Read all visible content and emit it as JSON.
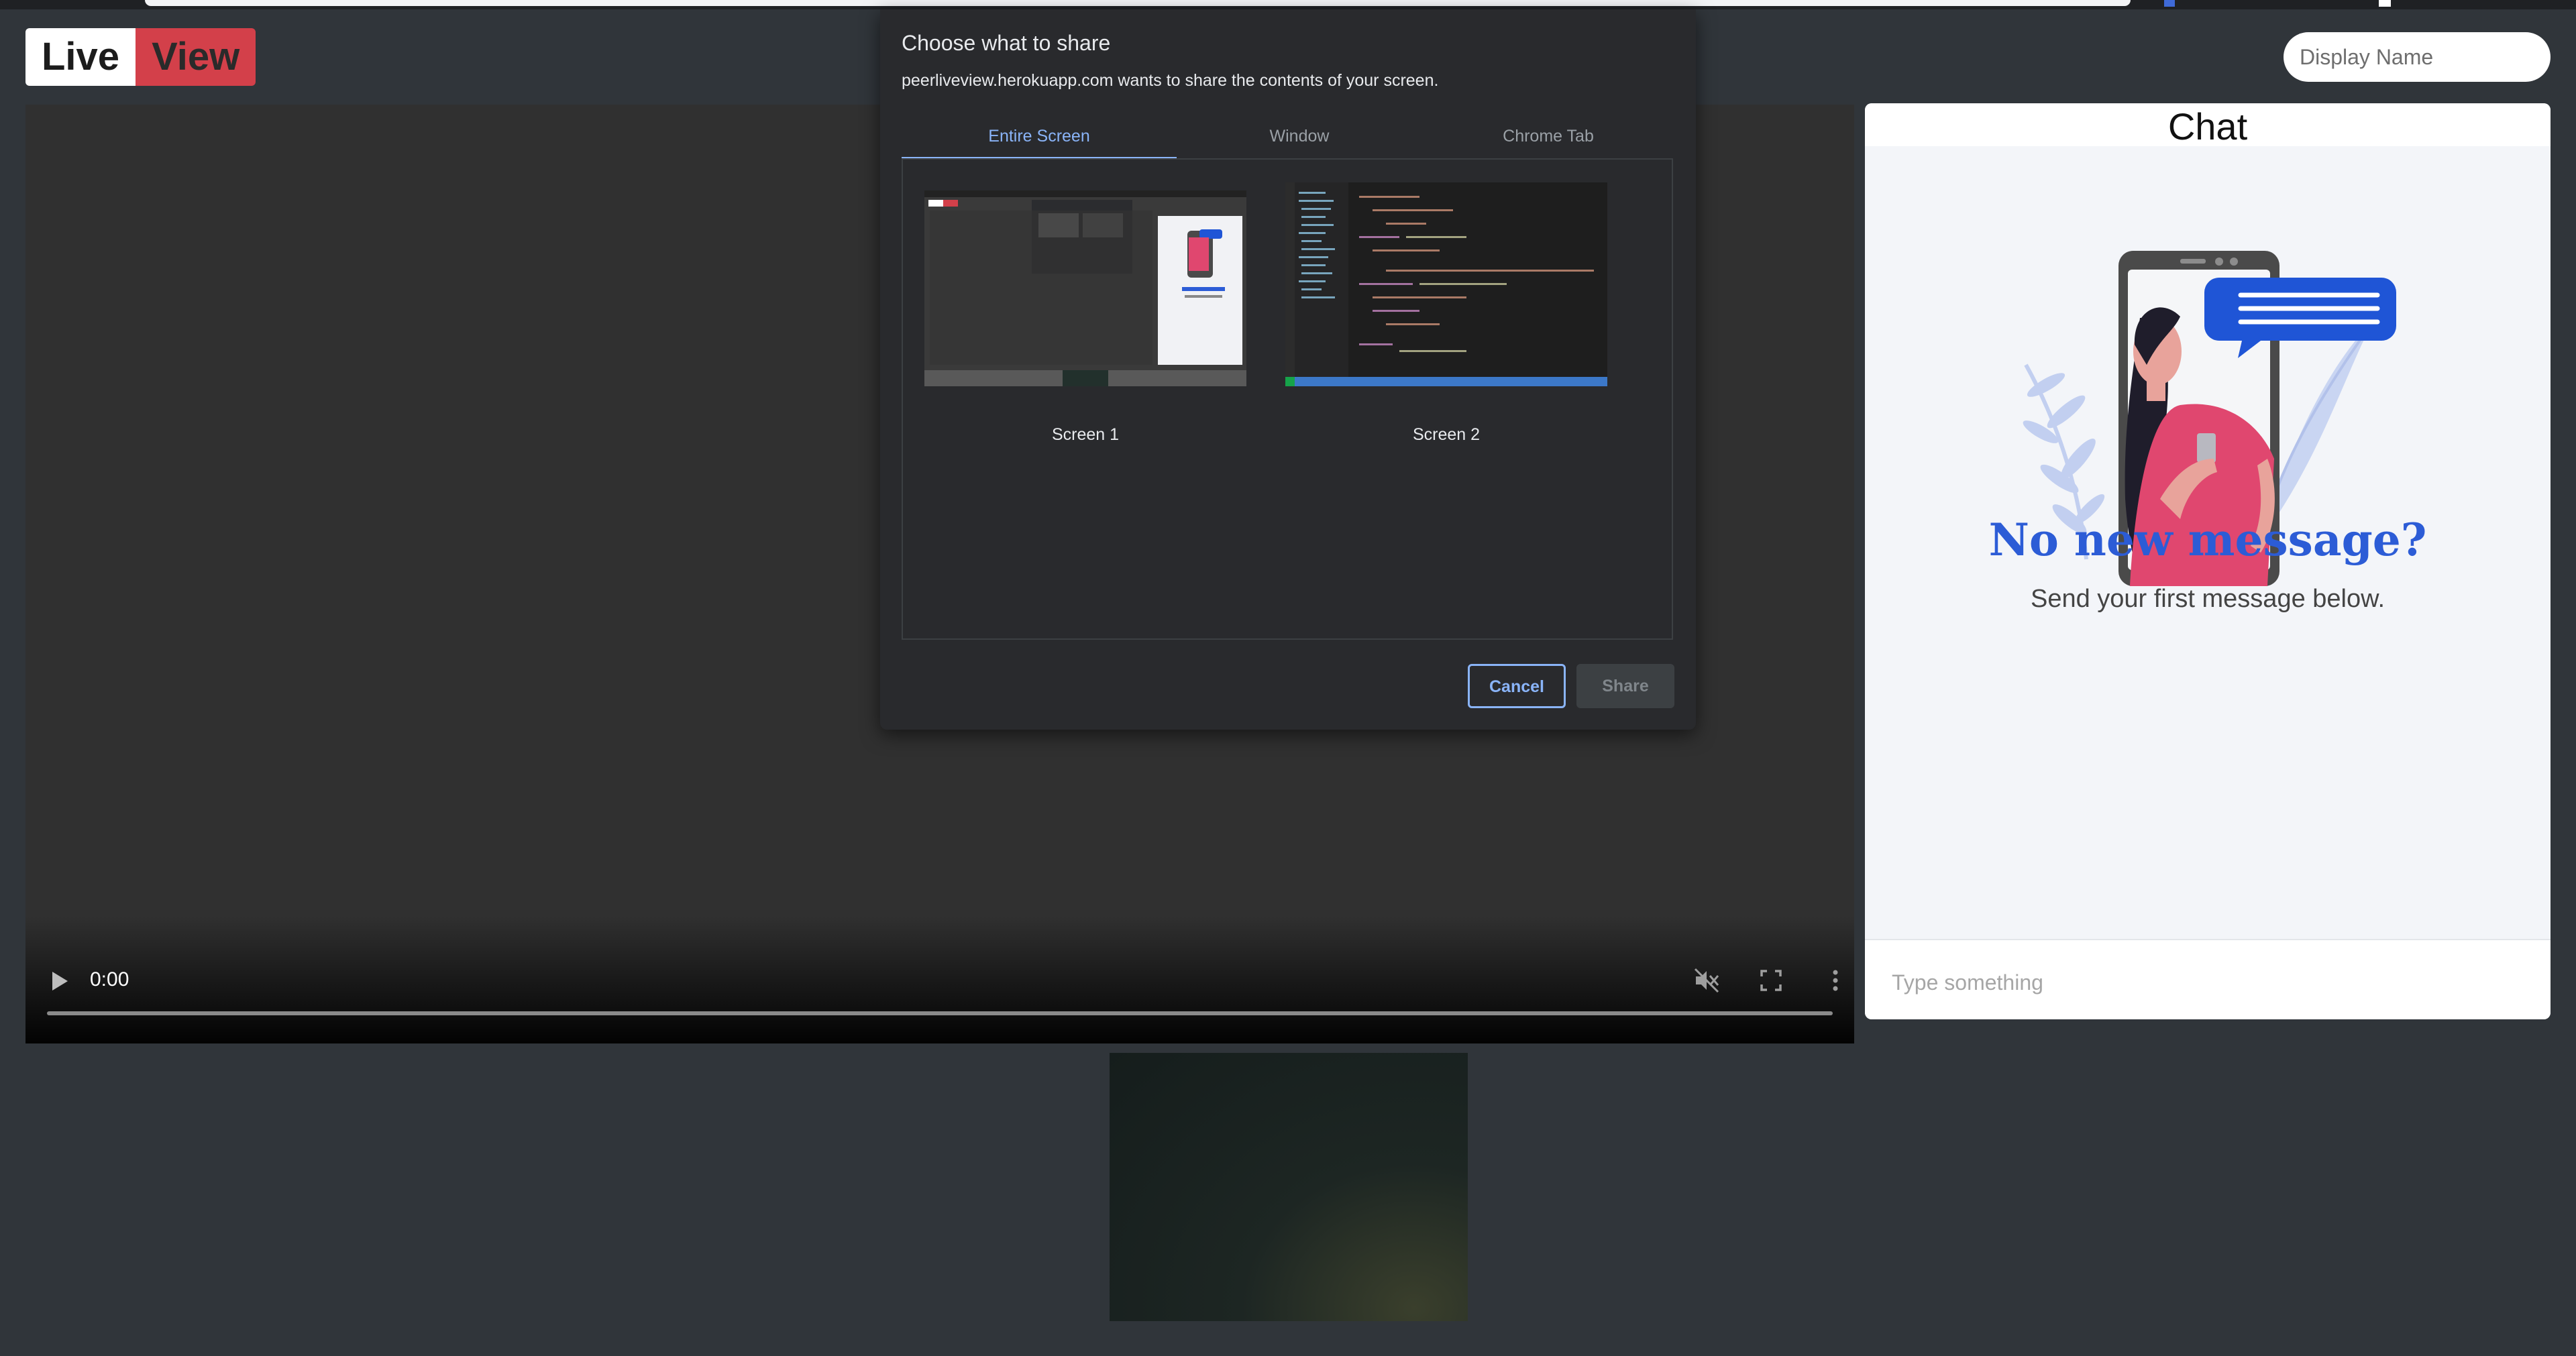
{
  "app": {
    "logo_part1": "Live",
    "logo_part2": "View",
    "display_name_placeholder": "Display Name"
  },
  "video": {
    "time": "0:00",
    "icons": [
      "play-icon",
      "mute-icon",
      "fullscreen-icon",
      "more-vert-icon"
    ]
  },
  "chat": {
    "title": "Chat",
    "empty_title": "No new message?",
    "empty_subtitle": "Send your first message below.",
    "input_placeholder": "Type something",
    "accent_color": "#2c5cd6"
  },
  "dialog": {
    "title": "Choose what to share",
    "description": "peerliveview.herokuapp.com wants to share the contents of your screen.",
    "tabs": [
      {
        "label": "Entire Screen",
        "active": true
      },
      {
        "label": "Window",
        "active": false
      },
      {
        "label": "Chrome Tab",
        "active": false
      }
    ],
    "sources": [
      {
        "label": "Screen 1"
      },
      {
        "label": "Screen 2"
      }
    ],
    "cancel_label": "Cancel",
    "share_label": "Share",
    "share_enabled": false
  }
}
